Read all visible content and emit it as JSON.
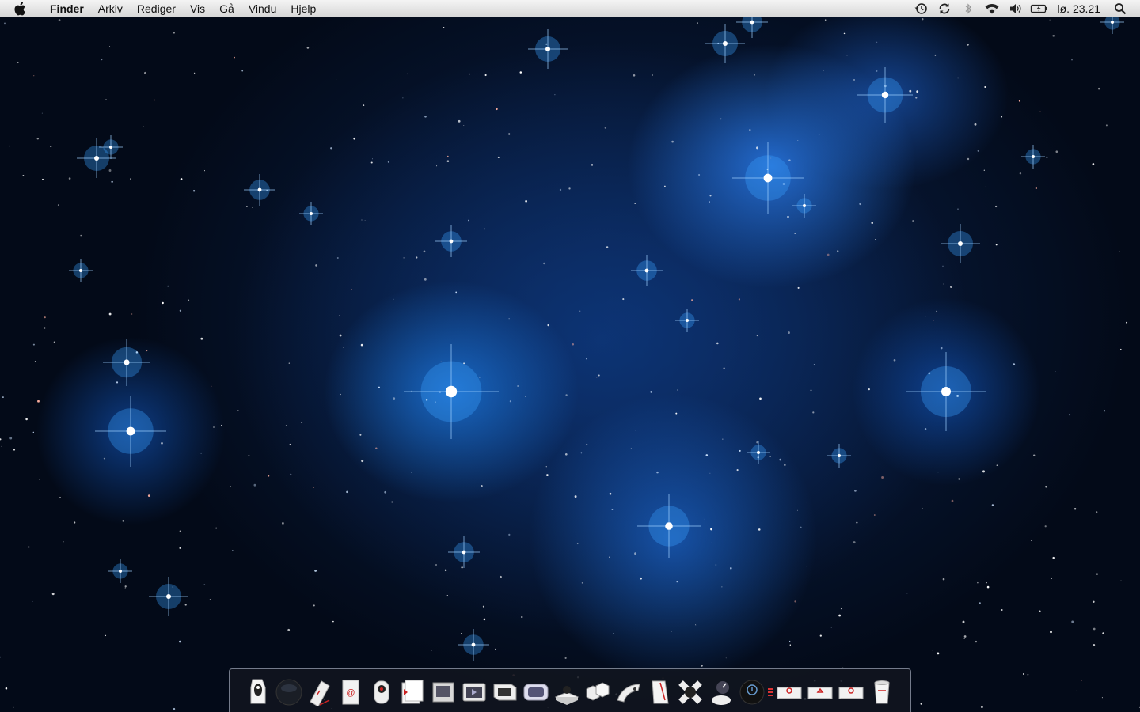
{
  "menubar": {
    "apple_icon": "apple-logo-icon",
    "items": [
      "Finder",
      "Arkiv",
      "Rediger",
      "Vis",
      "Gå",
      "Vindu",
      "Hjelp"
    ],
    "status_icons": [
      "time-machine-icon",
      "sync-icon",
      "bluetooth-icon",
      "wifi-icon",
      "volume-icon",
      "battery-icon"
    ],
    "clock": "lø. 23.21",
    "spotlight_icon": "spotlight-search-icon"
  },
  "dock": {
    "items": [
      {
        "icon": "finder-icon",
        "running": true
      },
      {
        "icon": "dashboard-icon",
        "running": true
      },
      {
        "icon": "pencil-note-icon",
        "running": true
      },
      {
        "icon": "mail-icon",
        "running": true
      },
      {
        "icon": "itunes-icon",
        "running": true
      },
      {
        "icon": "photo-booth-icon",
        "running": false
      },
      {
        "icon": "preview-icon",
        "running": false
      },
      {
        "icon": "quicktime-icon",
        "running": false
      },
      {
        "icon": "terminal-icon",
        "running": false
      },
      {
        "icon": "screen-sharing-icon",
        "running": false
      },
      {
        "icon": "disk-icon",
        "running": false
      },
      {
        "icon": "cubes-icon",
        "running": false
      },
      {
        "icon": "utility-icon",
        "running": false
      },
      {
        "icon": "textedit-icon",
        "running": false
      },
      {
        "icon": "system-preferences-icon",
        "running": false
      },
      {
        "icon": "activity-monitor-icon",
        "running": false
      },
      {
        "icon": "time-machine-icon",
        "running": false
      }
    ],
    "stacks": [
      "applications-stack-icon",
      "documents-stack-icon",
      "downloads-stack-icon",
      "trash-icon"
    ],
    "colors": {
      "run_dot": "#e33333"
    }
  }
}
